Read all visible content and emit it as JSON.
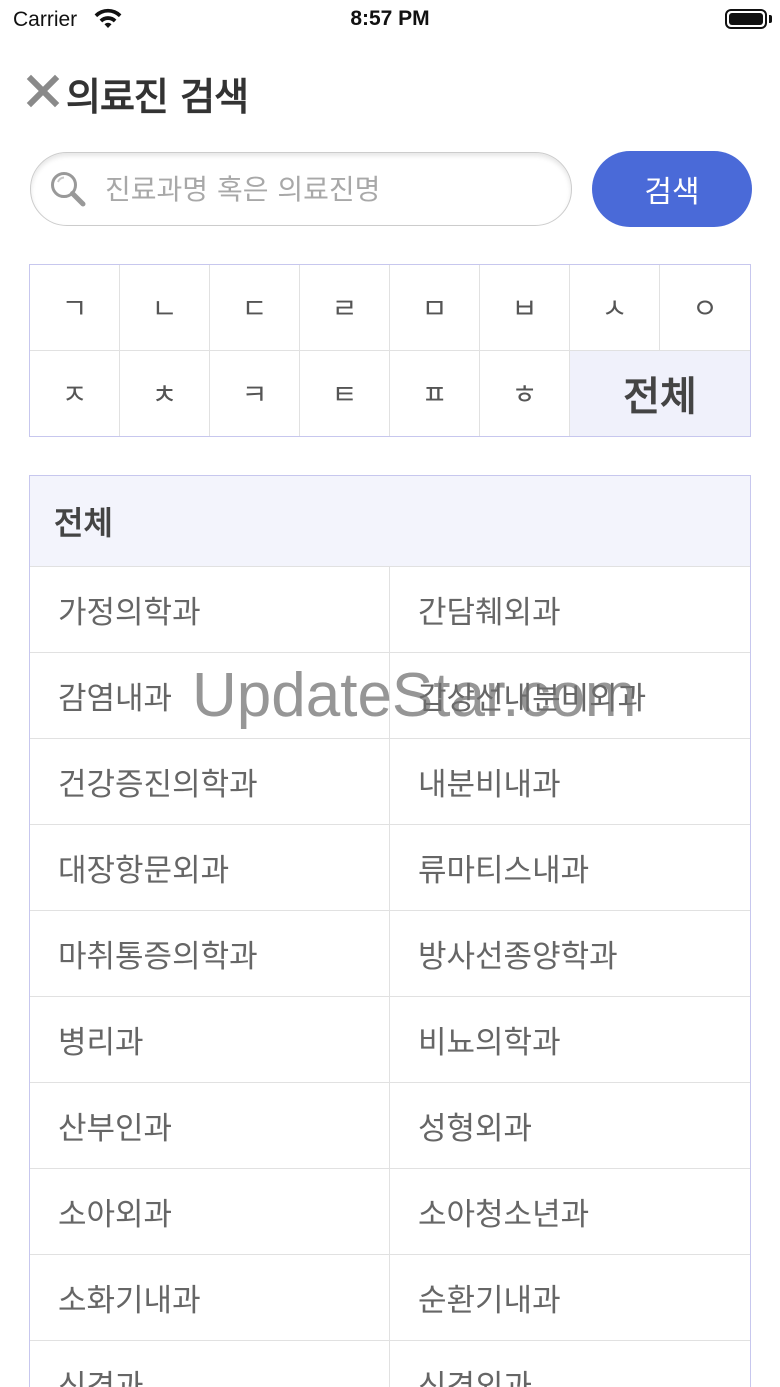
{
  "status_bar": {
    "carrier": "Carrier",
    "time": "8:57 PM"
  },
  "header": {
    "title": "의료진 검색",
    "close_icon": "close-icon"
  },
  "search": {
    "placeholder": "진료과명 혹은 의료진명",
    "value": "",
    "button_label": "검색",
    "icon": "search-icon",
    "accent_color": "#4a6ad8"
  },
  "consonants": {
    "row1": [
      "ㄱ",
      "ㄴ",
      "ㄷ",
      "ㄹ",
      "ㅁ",
      "ㅂ",
      "ㅅ",
      "ㅇ"
    ],
    "row2": [
      "ㅈ",
      "ㅊ",
      "ㅋ",
      "ㅌ",
      "ㅍ",
      "ㅎ"
    ],
    "all_label": "전체",
    "selected": "전체"
  },
  "departments": {
    "header": "전체",
    "items": [
      "가정의학과",
      "간담췌외과",
      "감염내과",
      "갑상선내분비외과",
      "건강증진의학과",
      "내분비내과",
      "대장항문외과",
      "류마티스내과",
      "마취통증의학과",
      "방사선종양학과",
      "병리과",
      "비뇨의학과",
      "산부인과",
      "성형외과",
      "소아외과",
      "소아청소년과",
      "소화기내과",
      "순환기내과",
      "신경과",
      "신경외과"
    ]
  },
  "watermark": "UpdateStar.com"
}
